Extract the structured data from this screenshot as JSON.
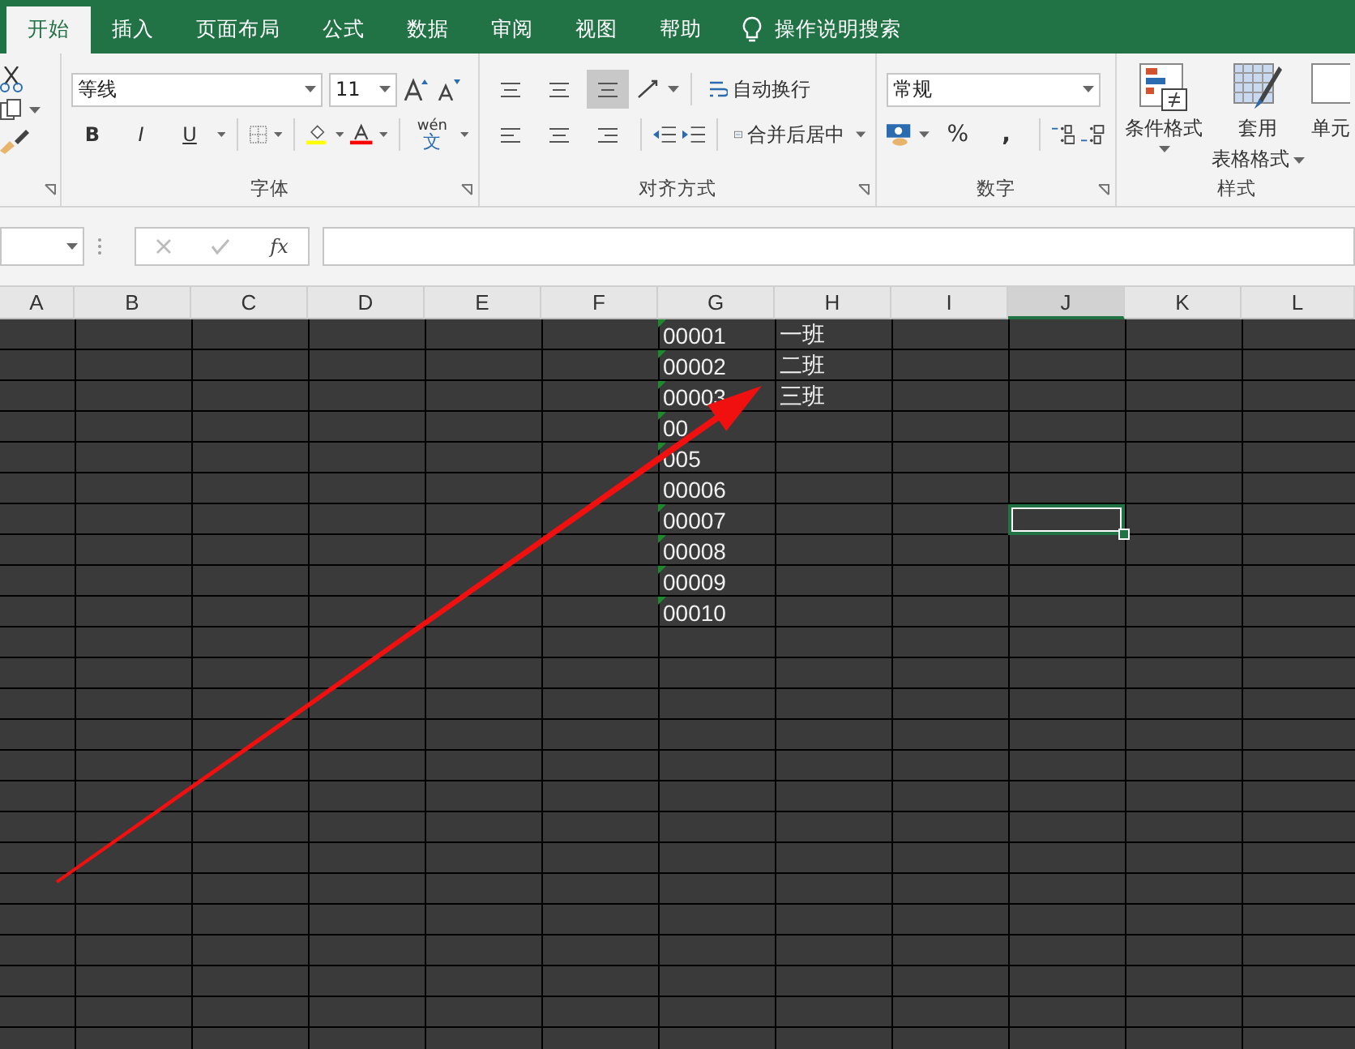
{
  "tabs": [
    {
      "label": "开始",
      "selected": true
    },
    {
      "label": "插入",
      "selected": false
    },
    {
      "label": "页面布局",
      "selected": false
    },
    {
      "label": "公式",
      "selected": false
    },
    {
      "label": "数据",
      "selected": false
    },
    {
      "label": "审阅",
      "selected": false
    },
    {
      "label": "视图",
      "selected": false
    },
    {
      "label": "帮助",
      "selected": false
    }
  ],
  "tell_me": "操作说明搜索",
  "ribbon": {
    "font": {
      "label": "字体",
      "font_name": "等线",
      "font_size": "11",
      "bold": "B",
      "italic": "I",
      "underline": "U",
      "phonetic_top": "wén",
      "phonetic_bottom": "文"
    },
    "alignment": {
      "label": "对齐方式",
      "wrap_text": "自动换行",
      "merge_center": "合并后居中"
    },
    "number": {
      "label": "数字",
      "format": "常规",
      "percent": "%",
      "comma": ","
    },
    "styles": {
      "label": "样式",
      "conditional": "条件格式",
      "table_top": "套用",
      "table_bottom": "表格格式",
      "cell_styles": "单元"
    }
  },
  "formula_bar": {
    "fx": "fx"
  },
  "table": {
    "columns": [
      {
        "label": "A",
        "selected": false
      },
      {
        "label": "B",
        "selected": false
      },
      {
        "label": "C",
        "selected": false
      },
      {
        "label": "D",
        "selected": false
      },
      {
        "label": "E",
        "selected": false
      },
      {
        "label": "F",
        "selected": false
      },
      {
        "label": "G",
        "selected": false,
        "cells": [
          {
            "text": "00001",
            "error_mark": true
          },
          {
            "text": "00002",
            "error_mark": true
          },
          {
            "text": "00003",
            "error_mark": true
          },
          {
            "text": "00",
            "error_mark": true
          },
          {
            "text": "005",
            "error_mark": true
          },
          {
            "text": "00006",
            "error_mark": false
          },
          {
            "text": "00007",
            "error_mark": true
          },
          {
            "text": "00008",
            "error_mark": true
          },
          {
            "text": "00009",
            "error_mark": true
          },
          {
            "text": "00010",
            "error_mark": true
          }
        ]
      },
      {
        "label": "H",
        "selected": false,
        "cells": [
          {
            "text": "一班"
          },
          {
            "text": "二班"
          },
          {
            "text": "三班"
          }
        ]
      },
      {
        "label": "I",
        "selected": false
      },
      {
        "label": "J",
        "selected": true,
        "cells": [
          {
            "selected": false
          },
          {
            "selected": false
          },
          {
            "selected": false
          },
          {
            "selected": false
          },
          {
            "selected": false
          },
          {
            "selected": false
          },
          {
            "selected": true
          }
        ]
      },
      {
        "label": "K",
        "selected": false
      },
      {
        "label": "L",
        "selected": false
      }
    ]
  }
}
